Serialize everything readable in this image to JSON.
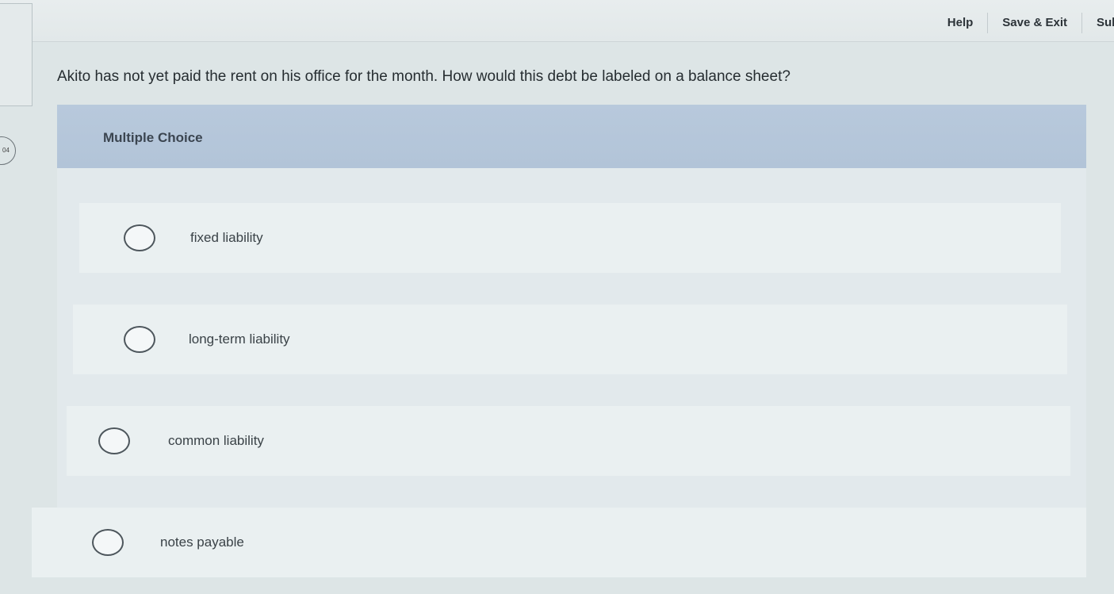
{
  "topbar": {
    "help_label": "Help",
    "save_exit_label": "Save & Exit",
    "submit_label": "Sub"
  },
  "question": {
    "text": "Akito has not yet paid the rent on his office for the month. How would this debt be labeled on a balance sheet?"
  },
  "multiple_choice": {
    "header": "Multiple Choice",
    "options": [
      {
        "label": "fixed liability"
      },
      {
        "label": "long-term liability"
      },
      {
        "label": "common liability"
      },
      {
        "label": "notes payable"
      }
    ]
  },
  "side_marker": {
    "text": "04"
  }
}
